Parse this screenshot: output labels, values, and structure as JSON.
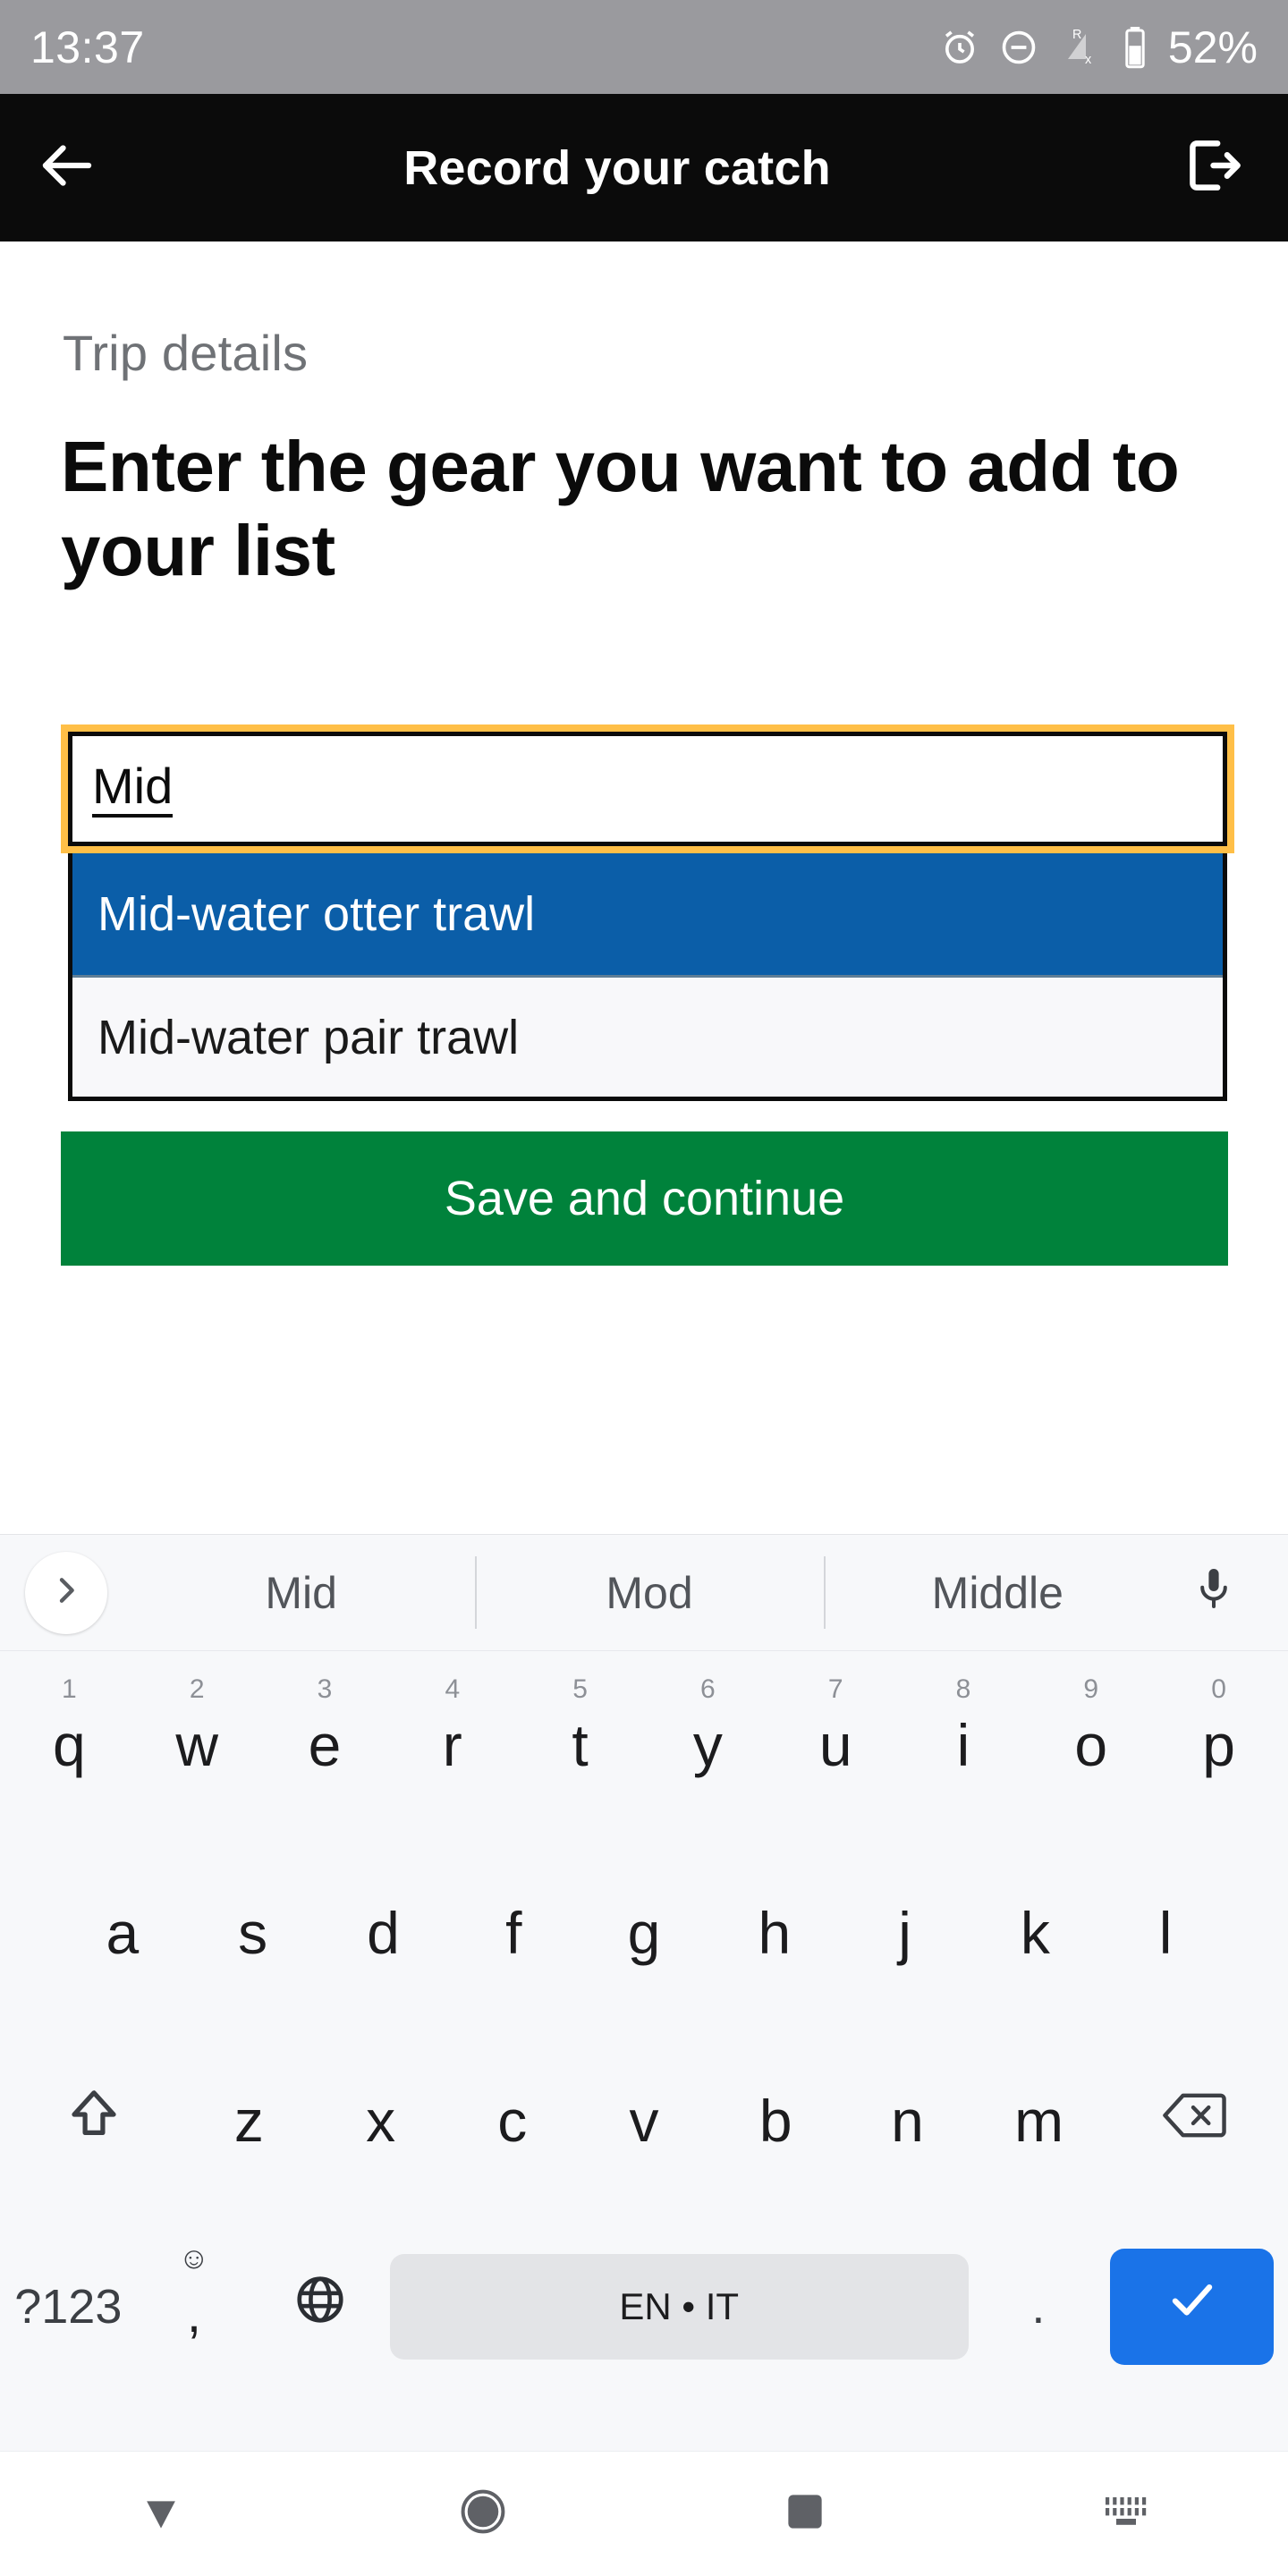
{
  "status_bar": {
    "time": "13:37",
    "battery_percent": "52%",
    "icons": [
      "alarm-icon",
      "do-not-disturb-icon",
      "signal-roaming-no-service-icon",
      "battery-icon"
    ],
    "signal_badge": "R",
    "signal_cross": "x",
    "background_color": "#9a9a9e"
  },
  "app_bar": {
    "title": "Record your catch",
    "back_icon": "back-arrow-icon",
    "exit_icon": "sign-out-icon",
    "background_color": "#0b0b0b",
    "text_color": "#ffffff"
  },
  "content": {
    "caption": "Trip details",
    "heading": "Enter the gear you want to add to your list",
    "gear_input": {
      "value": "Mid",
      "placeholder": "",
      "focus_ring_color": "#ffbf47",
      "border_color": "#0b0b0b"
    },
    "autocomplete": {
      "options": [
        {
          "label": "Mid-water otter trawl",
          "selected": true
        },
        {
          "label": "Mid-water pair trawl",
          "selected": false
        }
      ],
      "selected_background": "#0b5ea8",
      "list_background": "#f8f8fa"
    },
    "save_button": {
      "label": "Save and continue",
      "background_color": "#00823b",
      "text_color": "#ffffff"
    }
  },
  "keyboard": {
    "suggestions": {
      "expand_icon": "chevron-right-icon",
      "items": [
        "Mid",
        "Mod",
        "Middle"
      ],
      "mic_icon": "microphone-icon"
    },
    "row1": [
      {
        "key": "q",
        "num": "1"
      },
      {
        "key": "w",
        "num": "2"
      },
      {
        "key": "e",
        "num": "3"
      },
      {
        "key": "r",
        "num": "4"
      },
      {
        "key": "t",
        "num": "5"
      },
      {
        "key": "y",
        "num": "6"
      },
      {
        "key": "u",
        "num": "7"
      },
      {
        "key": "i",
        "num": "8"
      },
      {
        "key": "o",
        "num": "9"
      },
      {
        "key": "p",
        "num": "0"
      }
    ],
    "row2": [
      "a",
      "s",
      "d",
      "f",
      "g",
      "h",
      "j",
      "k",
      "l"
    ],
    "row3": {
      "shift_icon": "shift-up-arrow-icon",
      "keys": [
        "z",
        "x",
        "c",
        "v",
        "b",
        "n",
        "m"
      ],
      "backspace_icon": "backspace-icon"
    },
    "row4": {
      "symbols_label": "?123",
      "comma_label": ",",
      "emoji_icon": "smiley-icon",
      "globe_icon": "language-globe-icon",
      "space_label": "EN • IT",
      "period_label": ".",
      "enter_icon": "checkmark-icon",
      "enter_background": "#1a73e8",
      "space_background": "#e3e4e7"
    },
    "background_color": "#f7f8fa"
  },
  "nav_bar": {
    "back_icon": "nav-back-triangle-icon",
    "home_icon": "nav-home-circle-icon",
    "recents_icon": "nav-recents-square-icon",
    "keyboard_icon": "nav-keyboard-toggle-icon",
    "icon_color": "#5f6166"
  }
}
